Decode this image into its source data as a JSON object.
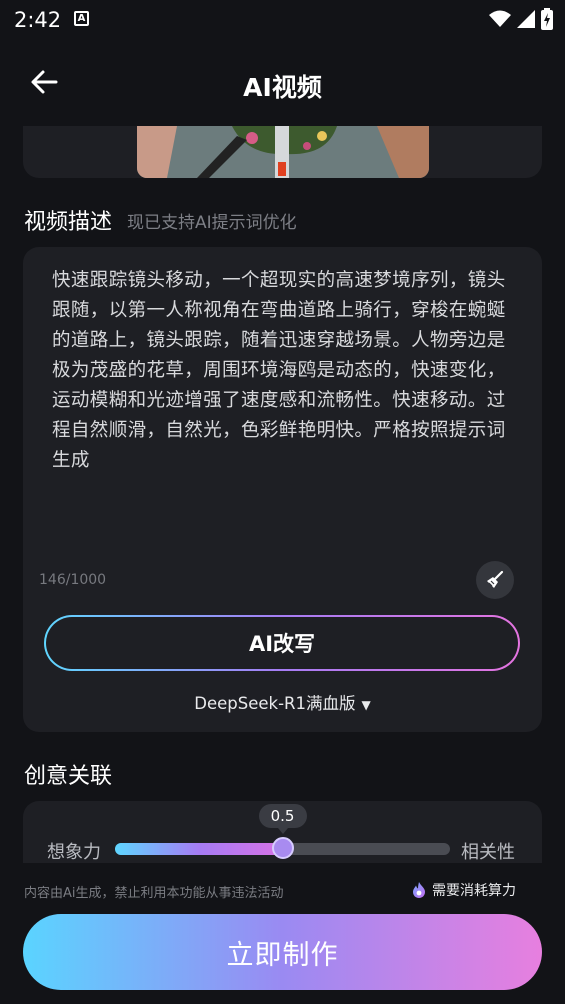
{
  "status_bar": {
    "time": "2:42",
    "notification_icon": "a-icon",
    "icons": [
      "wifi-icon",
      "signal-icon",
      "battery-icon"
    ]
  },
  "header": {
    "title": "AI视频",
    "back_icon": "arrow-left-icon"
  },
  "description": {
    "section_title": "视频描述",
    "hint": "现已支持AI提示词优化",
    "text": "快速跟踪镜头移动，一个超现实的高速梦境序列，镜头跟随，以第一人称视角在弯曲道路上骑行，穿梭在蜿蜒的道路上，镜头跟踪，随着迅速穿越场景。人物旁边是极为茂盛的花草，周围环境海鸥是动态的，快速变化，运动模糊和光迹增强了速度感和流畅性。快速移动。过程自然顺滑，自然光，色彩鲜艳明快。严格按照提示词生成",
    "char_count": "146/1000",
    "clear_icon": "broom-icon",
    "rewrite_label": "AI改写",
    "model": "DeepSeek-R1满血版"
  },
  "creative": {
    "section_title": "创意关联",
    "left_label": "想象力",
    "right_label": "相关性",
    "value_label": "0.5",
    "value": 0.5
  },
  "footer": {
    "disclaimer": "内容由Ai生成，禁止利用本功能从事违法活动",
    "cost_note": "需要消耗算力",
    "cost_icon": "flame-icon",
    "make_label": "立即制作"
  },
  "colors": {
    "background": "#121317",
    "card": "#1e1f24",
    "gradient_start": "#5ad4ff",
    "gradient_end": "#e77fdf"
  }
}
